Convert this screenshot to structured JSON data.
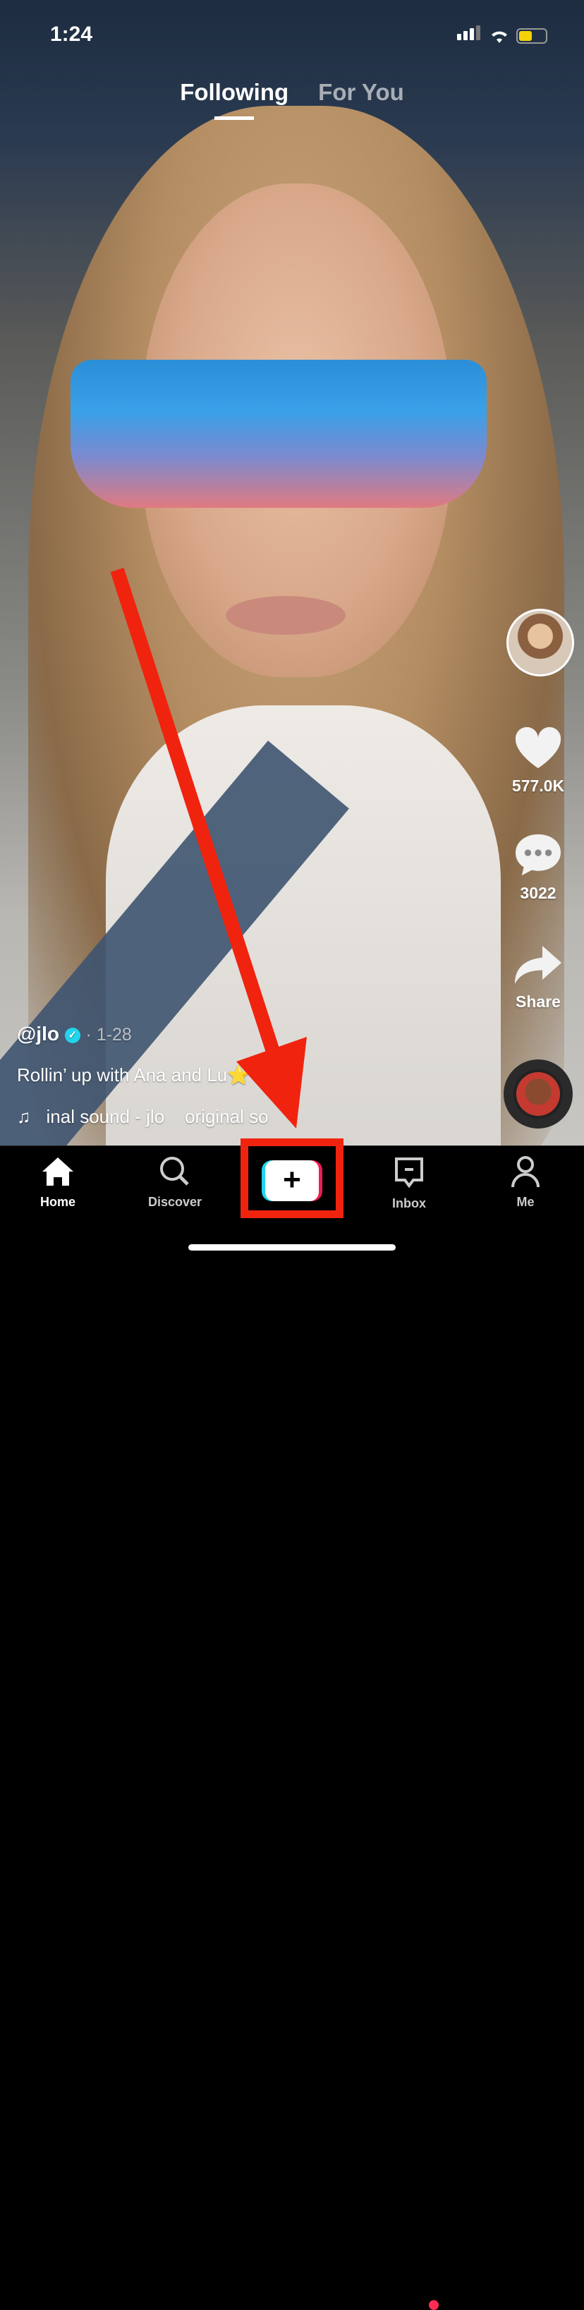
{
  "status_bar": {
    "time": "1:24",
    "signal_icon": "signal-icon",
    "wifi_icon": "wifi-icon",
    "battery_icon": "battery-charging-icon"
  },
  "feed_tabs": [
    {
      "label": "Following",
      "active": true
    },
    {
      "label": "For You",
      "active": false
    }
  ],
  "actions": {
    "like_count": "577.0K",
    "comment_count": "3022",
    "share_label": "Share"
  },
  "post": {
    "username": "@jlo",
    "verified": true,
    "date": "· 1-28",
    "caption": "Rollin’ up with Ana and Lu⭐❤️",
    "sound": "inal sound - jlo    original so"
  },
  "nav": [
    {
      "label": "Home",
      "icon": "home-icon",
      "active": true
    },
    {
      "label": "Discover",
      "icon": "search-icon"
    },
    {
      "label": "",
      "icon": "plus-icon"
    },
    {
      "label": "Inbox",
      "icon": "inbox-icon",
      "badge": true
    },
    {
      "label": "Me",
      "icon": "person-icon"
    }
  ],
  "colors": {
    "annotation": "#f0230f",
    "tiktok_cyan": "#20d5ec",
    "tiktok_red": "#ee1d52",
    "verified": "#20d5ec",
    "badge": "#fe2c55"
  }
}
